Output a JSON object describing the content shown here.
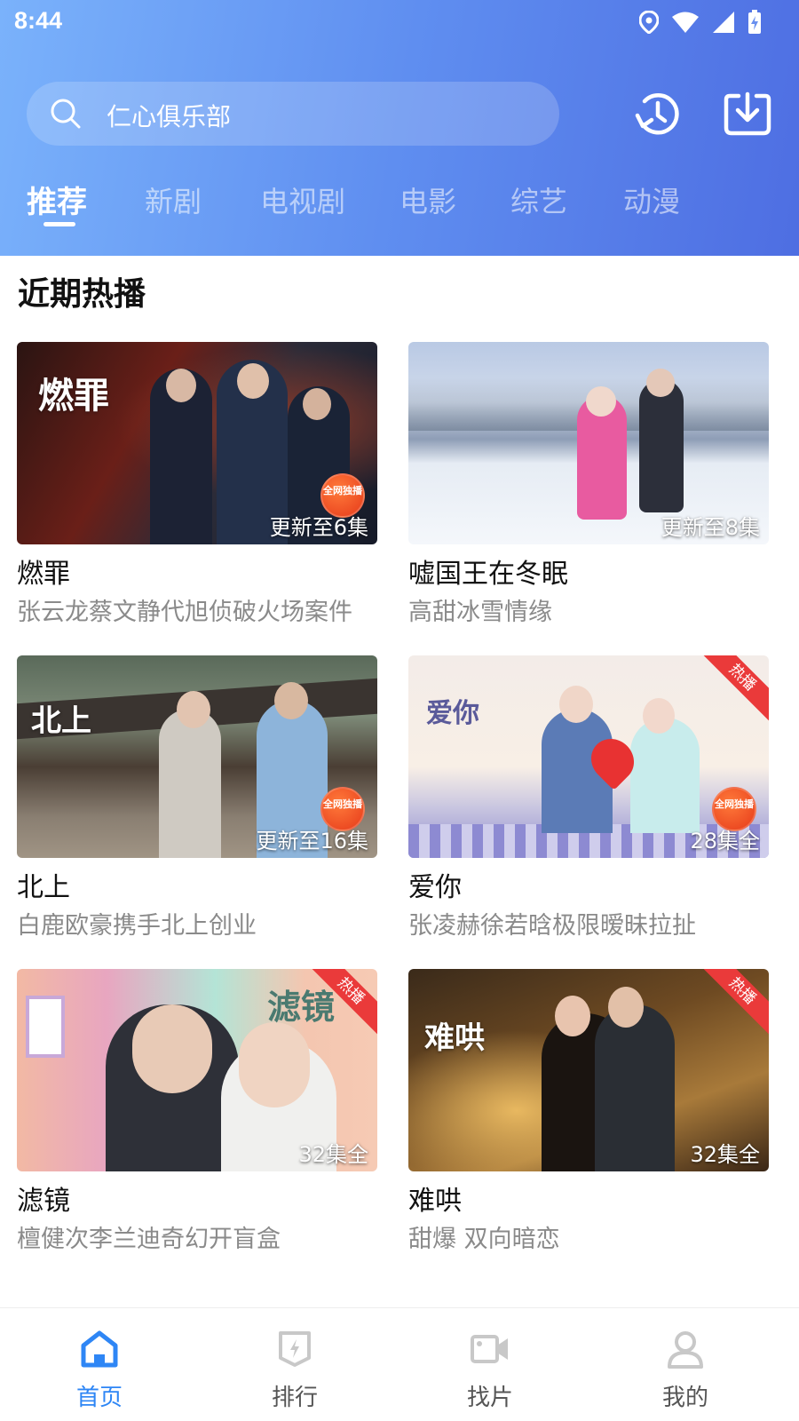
{
  "status": {
    "time": "8:44"
  },
  "search": {
    "text": "仁心俱乐部"
  },
  "tabs": [
    "推荐",
    "新剧",
    "电视剧",
    "电影",
    "综艺",
    "动漫"
  ],
  "section": {
    "title": "近期热播"
  },
  "cards": [
    {
      "badge": "更新至6集",
      "title": "燃罪",
      "subtitle": "张云龙蔡文静代旭侦破火场案件",
      "seal": "全网独播",
      "calligraphy": "燃罪"
    },
    {
      "badge": "更新至8集",
      "title": "嘘国王在冬眠",
      "subtitle": "高甜冰雪情缘"
    },
    {
      "badge": "更新至16集",
      "title": "北上",
      "subtitle": "白鹿欧豪携手北上创业",
      "seal": "全网独播",
      "calligraphy": "北上"
    },
    {
      "badge": "28集全",
      "title": "爱你",
      "subtitle": "张凌赫徐若晗极限暧昧拉扯",
      "seal": "全网独播",
      "ribbon": "热播",
      "calligraphy": "爱你"
    },
    {
      "badge": "32集全",
      "title": "滤镜",
      "subtitle": "檀健次李兰迪奇幻开盲盒",
      "ribbon": "热播",
      "calligraphy": "滤镜"
    },
    {
      "badge": "32集全",
      "title": "难哄",
      "subtitle": "甜爆 双向暗恋",
      "ribbon": "热播",
      "calligraphy": "难哄"
    }
  ],
  "bottom_nav": [
    "首页",
    "排行",
    "找片",
    "我的"
  ],
  "colors": {
    "accent": "#2e86f5",
    "header_start": "#7ab2fb",
    "header_end": "#4e6ee2",
    "ribbon": "#ea3a3a"
  }
}
